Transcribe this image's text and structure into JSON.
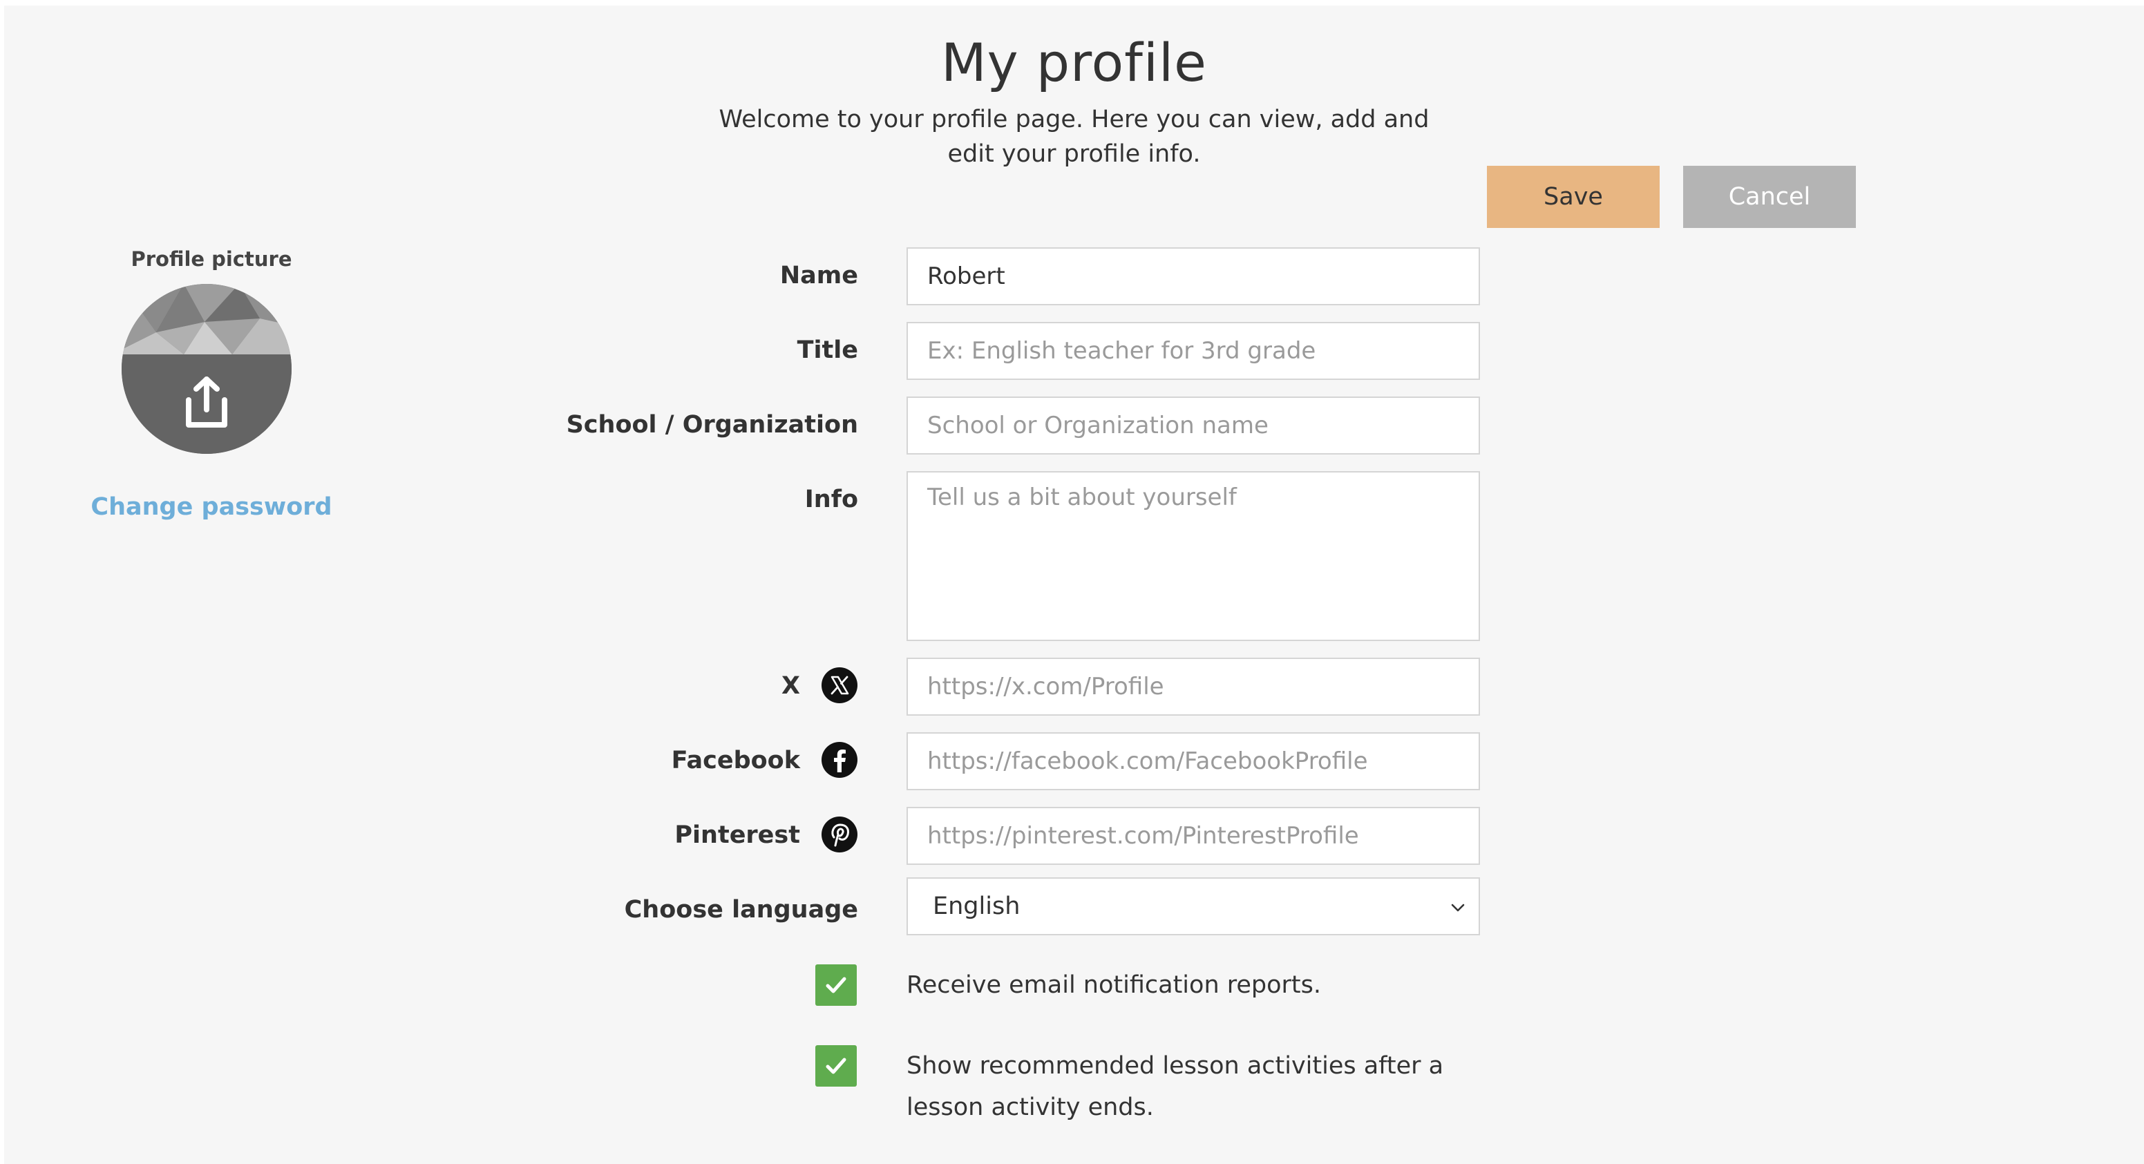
{
  "header": {
    "title": "My profile",
    "subtitle_line1": "Welcome to your profile page. Here you can view, add and",
    "subtitle_line2": "edit your profile info."
  },
  "actions": {
    "save_label": "Save",
    "cancel_label": "Cancel"
  },
  "sidebar": {
    "picture_label": "Profile picture",
    "upload_icon": "upload-icon",
    "change_password": "Change password"
  },
  "form": {
    "name": {
      "label": "Name",
      "value": "Robert",
      "placeholder": ""
    },
    "title": {
      "label": "Title",
      "value": "",
      "placeholder": "Ex: English teacher for 3rd grade"
    },
    "organization": {
      "label": "School / Organization",
      "value": "",
      "placeholder": "School or Organization name"
    },
    "info": {
      "label": "Info",
      "value": "",
      "placeholder": "Tell us a bit about yourself"
    },
    "x": {
      "label": "X",
      "icon": "x-logo-icon",
      "value": "",
      "placeholder": "https://x.com/Profile"
    },
    "facebook": {
      "label": "Facebook",
      "icon": "facebook-logo-icon",
      "value": "",
      "placeholder": "https://facebook.com/FacebookProfile"
    },
    "pinterest": {
      "label": "Pinterest",
      "icon": "pinterest-logo-icon",
      "value": "",
      "placeholder": "https://pinterest.com/PinterestProfile"
    },
    "language": {
      "label": "Choose language",
      "selected": "English"
    },
    "email_notifications": {
      "checked": true,
      "text": "Receive email notification reports."
    },
    "recommended_activities": {
      "checked": true,
      "text_line1": "Show recommended lesson activities after a",
      "text_line2": "lesson activity ends."
    }
  },
  "colors": {
    "page_background": "#f6f6f6",
    "save_button": "#e8b682",
    "cancel_button": "#b4b4b4",
    "link": "#6eaed9",
    "checkbox": "#5fac4e"
  }
}
